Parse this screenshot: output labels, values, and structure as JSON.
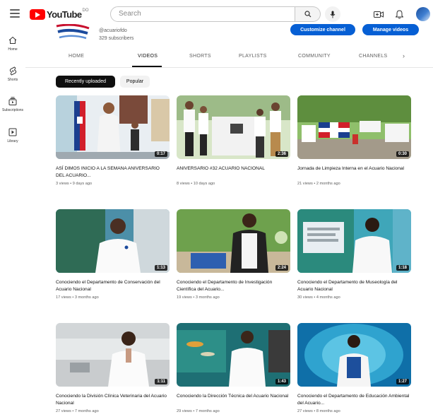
{
  "header": {
    "logo_text": "YouTube",
    "logo_country": "DO",
    "search_placeholder": "Search"
  },
  "rail": [
    {
      "label": "Home",
      "icon": "home-icon"
    },
    {
      "label": "Shorts",
      "icon": "shorts-icon"
    },
    {
      "label": "Subscriptions",
      "icon": "subscriptions-icon"
    },
    {
      "label": "Library",
      "icon": "library-icon"
    }
  ],
  "channel": {
    "handle": "@acuariofdo",
    "subscribers": "329 subscribers",
    "customize_label": "Customize channel",
    "manage_label": "Manage videos"
  },
  "tabs": [
    "HOME",
    "VIDEOS",
    "SHORTS",
    "PLAYLISTS",
    "COMMUNITY",
    "CHANNELS"
  ],
  "chips": {
    "recent": "Recently uploaded",
    "popular": "Popular"
  },
  "videos": [
    {
      "title": "ASÍ DIMOS INICIO A LA SEMANA ANIVERSARIO DEL ACUARIO...",
      "meta": "3 views • 9 days ago",
      "duration": "0:17"
    },
    {
      "title": "ANIVERSARIO #32 ACUARIO NACIONAL",
      "meta": "8 views • 10 days ago",
      "duration": "2:36"
    },
    {
      "title": "Jornada de Limpieza Interna en el Acuario Nacional",
      "meta": "21 views • 2 months ago",
      "duration": "0:30"
    },
    {
      "title": "Conociendo el Departamento de Conservación del Acuario Nacional",
      "meta": "17 views • 3 months ago",
      "duration": "1:13"
    },
    {
      "title": "Conociendo el Departamento de Investigación Científica del Acuario...",
      "meta": "19 views • 3 months ago",
      "duration": "2:24"
    },
    {
      "title": "Conociendo el Departamento de Museología del Acuario Nacional",
      "meta": "30 views • 4 months ago",
      "duration": "1:18"
    },
    {
      "title": "Conociendo la División Clínica Veterinaria del Acuario Nacional",
      "meta": "27 views • 7 months ago",
      "duration": "1:11"
    },
    {
      "title": "Conociendo la Dirección Técnica del Acuario Nacional",
      "meta": "29 views • 7 months ago",
      "duration": "1:43"
    },
    {
      "title": "Conociendo el Departamento de Educación Ambiental del Acuario...",
      "meta": "27 views • 8 months ago",
      "duration": "1:27"
    }
  ],
  "colors": {
    "accent": "#065fd4",
    "brand": "#ff0000"
  }
}
